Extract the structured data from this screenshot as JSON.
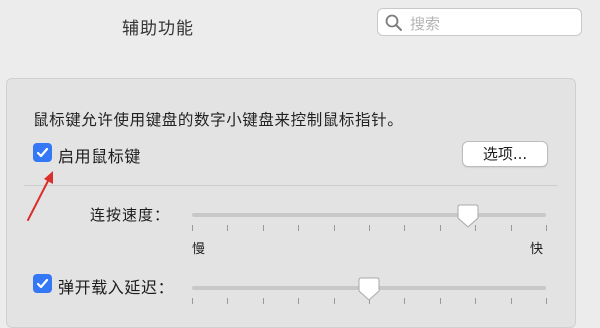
{
  "window": {
    "title": "辅助功能"
  },
  "search": {
    "placeholder": "搜索",
    "icon": "magnifier"
  },
  "description": "鼠标键允许使用键盘的数字小键盘来控制鼠标指针。",
  "mouse_keys": {
    "label": "启用鼠标键",
    "checked": true
  },
  "options_button": {
    "label": "选项..."
  },
  "speed_slider": {
    "label": "连按速度：",
    "min_label": "慢",
    "max_label": "快",
    "value_fraction": 0.78
  },
  "delay_setting": {
    "label": "弹开载入延迟：",
    "checked": true,
    "value_fraction": 0.5
  },
  "colors": {
    "accent": "#3478f6",
    "annotation_arrow": "#d9302b"
  }
}
